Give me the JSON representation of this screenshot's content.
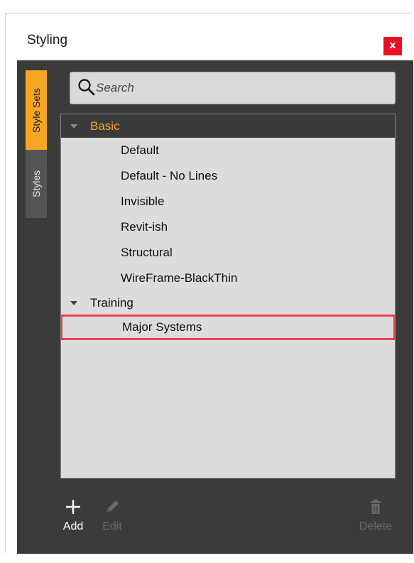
{
  "window": {
    "title": "Styling",
    "close_label": "x"
  },
  "tabs": [
    {
      "label": "Style Sets",
      "active": true
    },
    {
      "label": "Styles",
      "active": false
    }
  ],
  "search": {
    "placeholder": "Search",
    "value": ""
  },
  "tree": {
    "groups": [
      {
        "label": "Basic",
        "expanded": true,
        "selected": true,
        "items": [
          "Default",
          "Default - No Lines",
          "Invisible",
          "Revit-ish",
          "Structural",
          "WireFrame-BlackThin"
        ]
      },
      {
        "label": "Training",
        "expanded": true,
        "selected": false,
        "items": [
          "Major Systems"
        ],
        "highlighted_item": "Major Systems"
      }
    ]
  },
  "toolbar": {
    "add_label": "Add",
    "edit_label": "Edit",
    "delete_label": "Delete",
    "add_icon": "plus-icon",
    "edit_icon": "pencil-icon",
    "delete_icon": "trash-icon"
  },
  "colors": {
    "accent": "#f5a623",
    "panel_bg": "#3b3b3b",
    "tree_bg": "#dcdcdc",
    "close_red": "#e81123",
    "highlight_border": "#e8434a"
  }
}
